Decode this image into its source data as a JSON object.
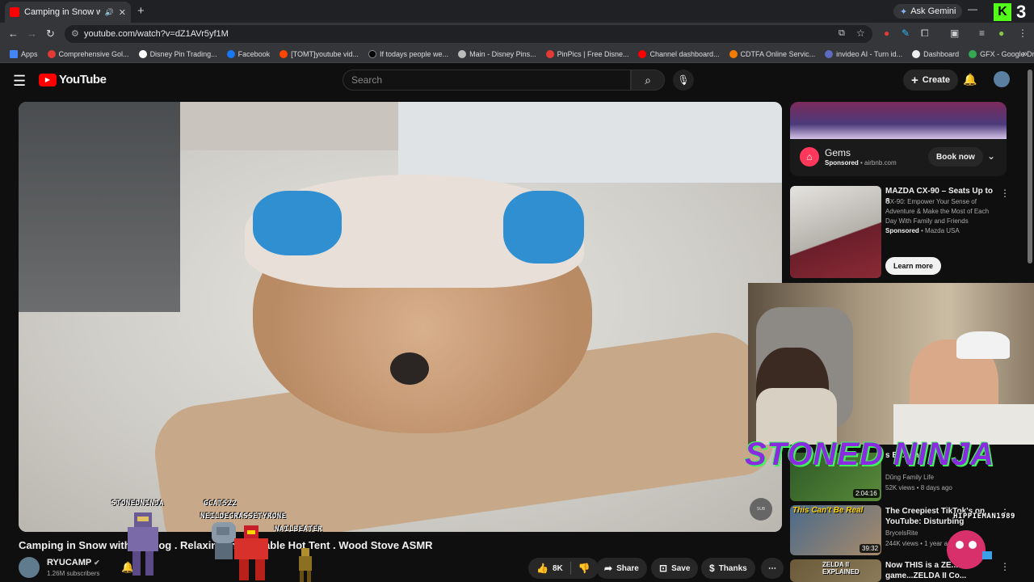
{
  "browser": {
    "tab_title": "Camping in Snow with My",
    "tab_close": "✕",
    "new_tab": "+",
    "gemini_label": "Ask Gemini",
    "kick_badge": "3",
    "url": "youtube.com/watch?v=dZ1AVr5yf1M",
    "bookmarks": [
      {
        "label": "Apps",
        "color": "#4285f4"
      },
      {
        "label": "Comprehensive Gol...",
        "color": "#e53935"
      },
      {
        "label": "Disney Pin Trading...",
        "color": "#ffffff"
      },
      {
        "label": "Facebook",
        "color": "#1877f2"
      },
      {
        "label": "[TOMT]youtube vid...",
        "color": "#ff4500"
      },
      {
        "label": "If todays people we...",
        "color": "#000000"
      },
      {
        "label": "Main - Disney Pins...",
        "color": "#bbbbbb"
      },
      {
        "label": "PinPics | Free Disne...",
        "color": "#e53935"
      },
      {
        "label": "Channel dashboard...",
        "color": "#ff0000"
      },
      {
        "label": "CDTFA Online Servic...",
        "color": "#f57c00"
      },
      {
        "label": "invideo AI - Turn id...",
        "color": "#5c6bc0"
      },
      {
        "label": "Dashboard",
        "color": "#eeeeee"
      },
      {
        "label": "GFX - Google Drive",
        "color": "#34a853"
      }
    ]
  },
  "youtube": {
    "logo_text": "YouTube",
    "search_placeholder": "Search",
    "create_label": "Create"
  },
  "video": {
    "title": "Camping in Snow with My Dog . Relaxing in Inflatable Hot Tent . Wood Stove ASMR",
    "channel": "RYUCAMP",
    "subscribers": "1.26M subscribers",
    "likes": "8K",
    "share_label": "Share",
    "save_label": "Save",
    "thanks_label": "Thanks"
  },
  "sidebar": {
    "ad1": {
      "name": "Gems",
      "sponsored": "Sponsored",
      "domain": "airbnb.com",
      "cta": "Book now"
    },
    "ad2": {
      "title": "MAZDA CX-90 – Seats Up to 8",
      "desc": "CX-90: Empower Your Sense of Adventure & Make the Most of Each Day With Family and Friends",
      "sponsored": "Sponsored",
      "advertiser": "Mazda USA",
      "cta": "Learn more"
    },
    "videos": [
      {
        "title": "s E... ton",
        "channel": "Dũng Family Life",
        "meta": "52K views • 8 days ago",
        "duration": "2:04:16"
      },
      {
        "title": "The Creepiest TikTok's on YouTube: Disturbing",
        "channel": "BrycelsRite",
        "meta": "244K views • 1 year ago",
        "duration": "39:32",
        "thumb_text": "This Can't Be Real"
      },
      {
        "title": "Now THIS is a ZE... game...ZELDA II Co...",
        "channel": "",
        "meta": "",
        "duration": "",
        "thumb_text": "ZELDA II EXPLAINED"
      }
    ]
  },
  "stream_overlay": {
    "banner": "STONED NINJA",
    "sprite_names": [
      "STONEDNINJA",
      "GCAT522",
      "NEILDEGRASSETYRONE",
      "NAILBEATER",
      "HIPPIEMAN1989"
    ]
  }
}
